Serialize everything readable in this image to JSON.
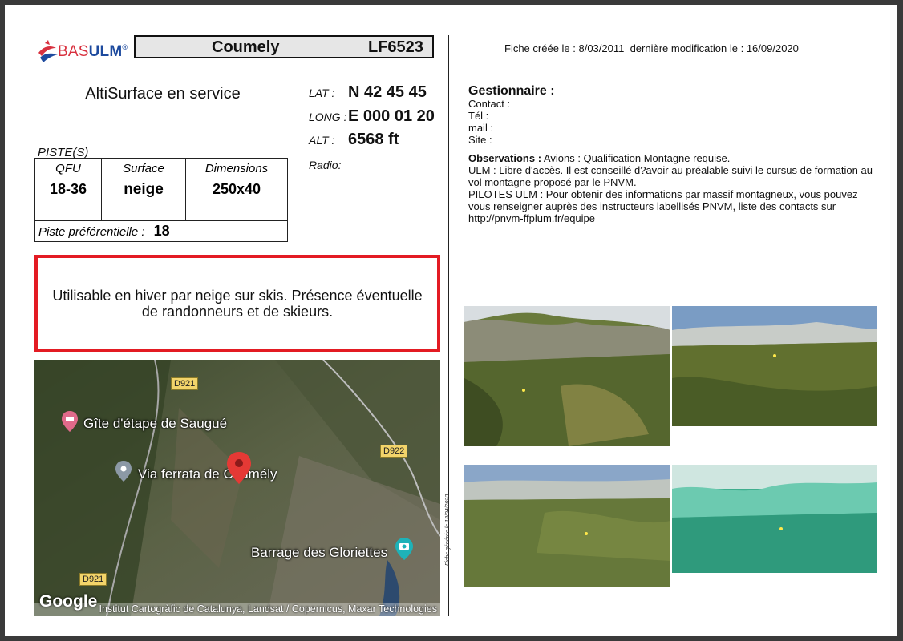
{
  "logo": {
    "part1": "BAS",
    "part2": "ULM",
    "mark": "®"
  },
  "header": {
    "name": "Coumely",
    "code": "LF6523"
  },
  "status": "AltiSurface en service",
  "coords": {
    "lat_label": "LAT :",
    "lat": "N 42 45 45",
    "long_label": "LONG :",
    "long": "E 000 01 20",
    "alt_label": "ALT :",
    "alt": "6568 ft",
    "radio_label": "Radio:"
  },
  "piste": {
    "section_label": "PISTE(S)",
    "headers": [
      "QFU",
      "Surface",
      "Dimensions"
    ],
    "row": [
      "18-36",
      "neige",
      "250x40"
    ],
    "pref_label": "Piste préférentielle :",
    "pref_value": "18"
  },
  "notice": "Utilisable en hiver par neige sur skis. Présence éventuelle de randonneurs et de skieurs.",
  "map": {
    "roads": [
      "D921",
      "D922",
      "D921"
    ],
    "places": [
      "Gîte d'étape de Saugué",
      "Via ferrata de Coumély",
      "Barrage des Gloriettes"
    ],
    "google": "Google",
    "attribution": "Institut Cartogràfic de Catalunya, Landsat / Copernicus, Maxar Technologies"
  },
  "meta": "Fiche créée le : 8/03/2011  dernière modification le : 16/09/2020",
  "gestionnaire": {
    "title": "Gestionnaire :",
    "contact": "Contact :",
    "tel": "Tél :",
    "mail": "mail :",
    "site": "Site :"
  },
  "observations": {
    "label": "Observations :",
    "line1": " Avions : Qualification Montagne requise.",
    "ulm": "ULM : Libre d'accès. Il est conseillé d?avoir au préalable suivi le cursus de formation au vol montagne proposé par le PNVM.",
    "pilotes": "PILOTES ULM : Pour obtenir des informations par massif montagneux, vous pouvez vous renseigner auprès des instructeurs labellisés PNVM, liste des contacts sur http://pnvm-ffplum.fr/equipe"
  },
  "generated": "Fiche générée le 13/04/2023",
  "colors": {
    "notice_border": "#e31b23",
    "header_bg": "#e6e6e6",
    "logo_blue": "#1d4a9e",
    "logo_red": "#d8313f"
  }
}
